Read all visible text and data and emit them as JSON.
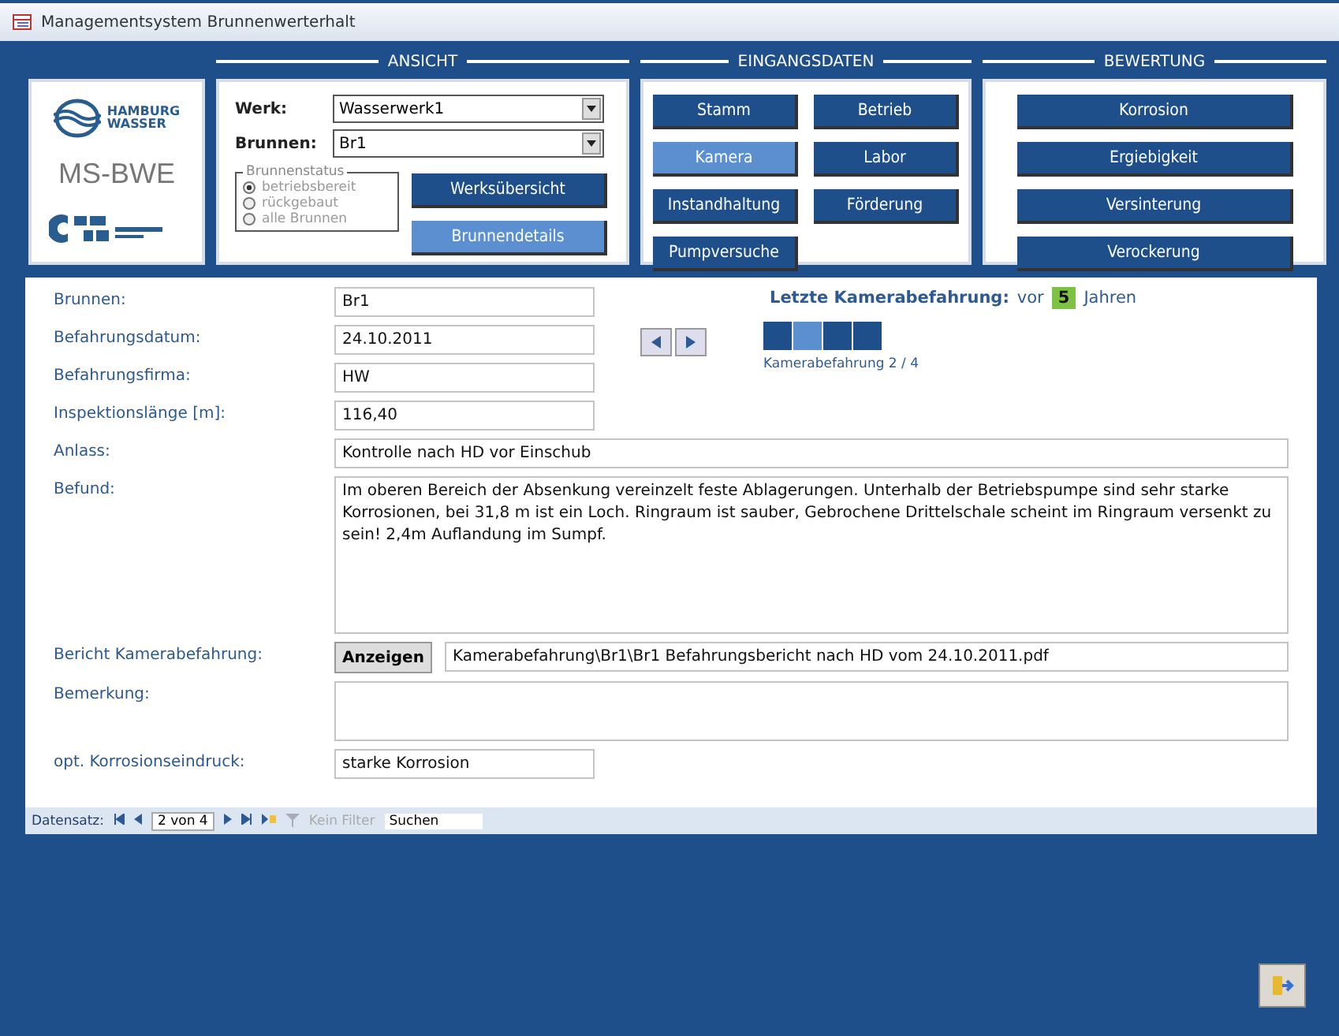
{
  "window": {
    "title": "Managementsystem Brunnenwerterhalt"
  },
  "logos": {
    "brand_top": "HAMBURG",
    "brand_bottom": "WASSER",
    "app_name": "MS-BWE"
  },
  "ansicht": {
    "heading": "ANSICHT",
    "fields": [
      {
        "label": "Werk:",
        "value": "Wasserwerk1"
      },
      {
        "label": "Brunnen:",
        "value": "Br1"
      }
    ],
    "status_group": {
      "legend": "Brunnenstatus",
      "disabled": true,
      "options": [
        {
          "label": "betriebsbereit",
          "selected": true
        },
        {
          "label": "rückgebaut",
          "selected": false
        },
        {
          "label": "alle Brunnen",
          "selected": false
        }
      ]
    },
    "buttons": [
      {
        "label": "Werksübersicht",
        "selected": false
      },
      {
        "label": "Brunnendetails",
        "selected": true
      }
    ]
  },
  "eingangsdaten": {
    "heading": "EINGANGSDATEN",
    "buttons": [
      {
        "label": "Stamm",
        "selected": false
      },
      {
        "label": "Betrieb",
        "selected": false
      },
      {
        "label": "Kamera",
        "selected": true
      },
      {
        "label": "Labor",
        "selected": false
      },
      {
        "label": "Instandhaltung",
        "selected": false
      },
      {
        "label": "Förderung",
        "selected": false
      },
      {
        "label": "Pumpversuche",
        "selected": false
      }
    ]
  },
  "bewertung": {
    "heading": "BEWERTUNG",
    "buttons": [
      {
        "label": "Korrosion",
        "selected": false
      },
      {
        "label": "Ergiebigkeit",
        "selected": false
      },
      {
        "label": "Versinterung",
        "selected": false
      },
      {
        "label": "Verockerung",
        "selected": false
      }
    ]
  },
  "form": {
    "fields": [
      {
        "label": "Brunnen:",
        "value": "Br1"
      },
      {
        "label": "Befahrungsdatum:",
        "value": "24.10.2011"
      },
      {
        "label": "Befahrungsfirma:",
        "value": "HW"
      },
      {
        "label": "Inspektionslänge [m]:",
        "value": "116,40"
      }
    ],
    "last_inspection": {
      "label": "Letzte Kamerabefahrung:",
      "prefix": "vor",
      "years": "5",
      "suffix": "Jahren"
    },
    "pager": {
      "segments": [
        {
          "selected": false
        },
        {
          "selected": true
        },
        {
          "selected": false
        },
        {
          "selected": false
        }
      ],
      "caption": "Kamerabefahrung 2 / 4"
    },
    "anlass": {
      "label": "Anlass:",
      "value": "Kontrolle nach HD vor Einschub"
    },
    "befund": {
      "label": "Befund:",
      "value": "Im oberen Bereich der Absenkung vereinzelt feste Ablagerungen. Unterhalb der Betriebspumpe sind sehr starke Korrosionen, bei 31,8 m ist ein Loch. Ringraum ist sauber, Gebrochene Drittelschale scheint im Ringraum versenkt zu sein! 2,4m Auflandung im Sumpf."
    },
    "bericht": {
      "label": "Bericht Kamerabefahrung:",
      "button": "Anzeigen",
      "value": "Kamerabefahrung\\Br1\\Br1 Befahrungsbericht nach HD vom 24.10.2011.pdf"
    },
    "bemerkung": {
      "label": "Bemerkung:"
    },
    "korrosion": {
      "label": "opt. Korrosionseindruck:",
      "value": "starke Korrosion"
    }
  },
  "record_nav": {
    "label": "Datensatz:",
    "position": "2 von 4",
    "filter": "Kein Filter",
    "search": "Suchen"
  }
}
